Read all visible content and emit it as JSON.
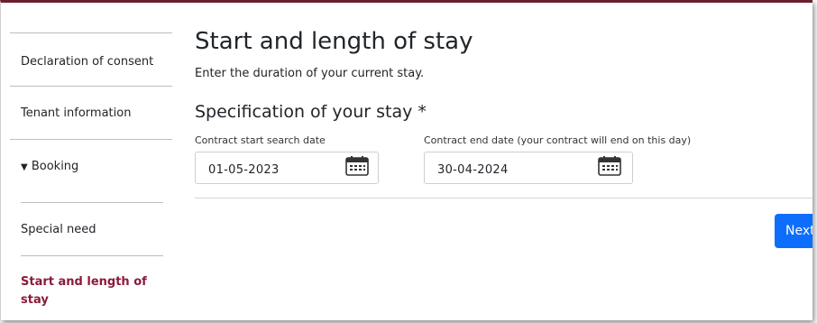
{
  "sidebar": {
    "items": [
      {
        "label": "Declaration of consent"
      },
      {
        "label": "Tenant information"
      },
      {
        "label": "Booking",
        "expander": "▼"
      },
      {
        "label": "Special need"
      },
      {
        "label": "Start and length of stay",
        "active": true
      }
    ]
  },
  "page": {
    "title": "Start and length of stay",
    "subtitle": "Enter the duration of your current stay."
  },
  "section": {
    "title": "Specification of your stay *"
  },
  "fields": {
    "start": {
      "label": "Contract start search date",
      "value": "01-05-2023",
      "icon": "calendar-icon"
    },
    "end": {
      "label": "Contract end date (your contract will end on this day)",
      "value": "30-04-2024",
      "icon": "calendar-icon"
    }
  },
  "actions": {
    "next_label": "Next"
  },
  "colors": {
    "accent": "#8b1a3a",
    "primary_button": "#0d6efd",
    "top_border": "#6b1f2e"
  }
}
